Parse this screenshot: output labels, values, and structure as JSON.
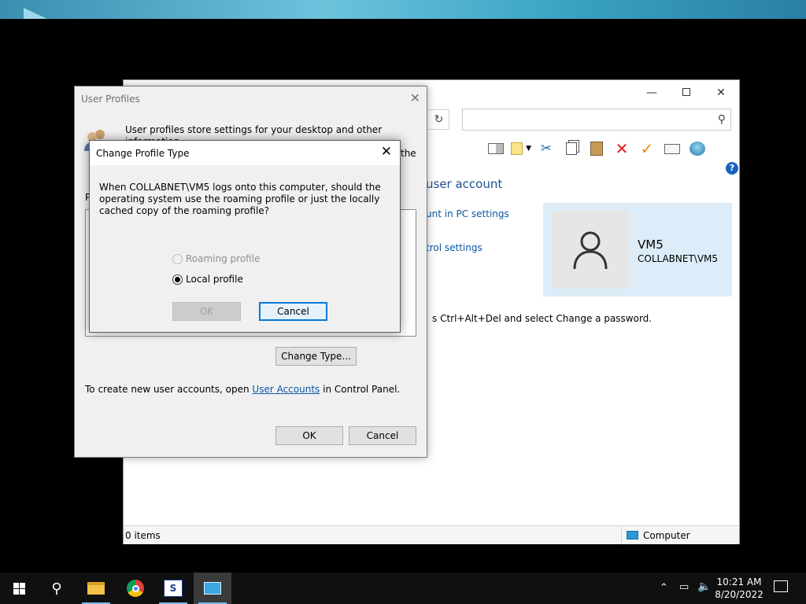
{
  "control_panel": {
    "heading": "user account",
    "link_pc_settings": "unt in PC settings",
    "link_control_settings": "trol settings",
    "ctrl_alt_del": "s Ctrl+Alt+Del and select Change a password.",
    "account_name": "VM5",
    "account_domain": "COLLABNET\\VM5",
    "status_items": "0 items",
    "status_location": "Computer"
  },
  "user_profiles": {
    "title": "User Profiles",
    "description_line1": "User profiles store settings for your desktop and other information",
    "description_line3": "the",
    "profiles_label": "P",
    "change_type_label": "Change Type...",
    "create_text_prefix": "To create new user accounts, open ",
    "create_link": "User Accounts",
    "create_text_suffix": " in Control Panel.",
    "ok_label": "OK",
    "cancel_label": "Cancel"
  },
  "change_profile_type": {
    "title": "Change Profile Type",
    "question": "When COLLABNET\\VM5 logs onto this computer, should the operating system use the roaming profile or just the locally cached copy of the roaming profile?",
    "options": [
      {
        "label": "Roaming profile",
        "selected": false,
        "enabled": false
      },
      {
        "label": "Local profile",
        "selected": true,
        "enabled": true
      }
    ],
    "ok_label": "OK",
    "cancel_label": "Cancel"
  },
  "taskbar": {
    "time": "10:21 AM",
    "date": "8/20/2022"
  },
  "colors": {
    "accent": "#0078d7",
    "link": "#0b57a5",
    "account_panel": "#dcecf8",
    "taskbar": "#101010"
  }
}
